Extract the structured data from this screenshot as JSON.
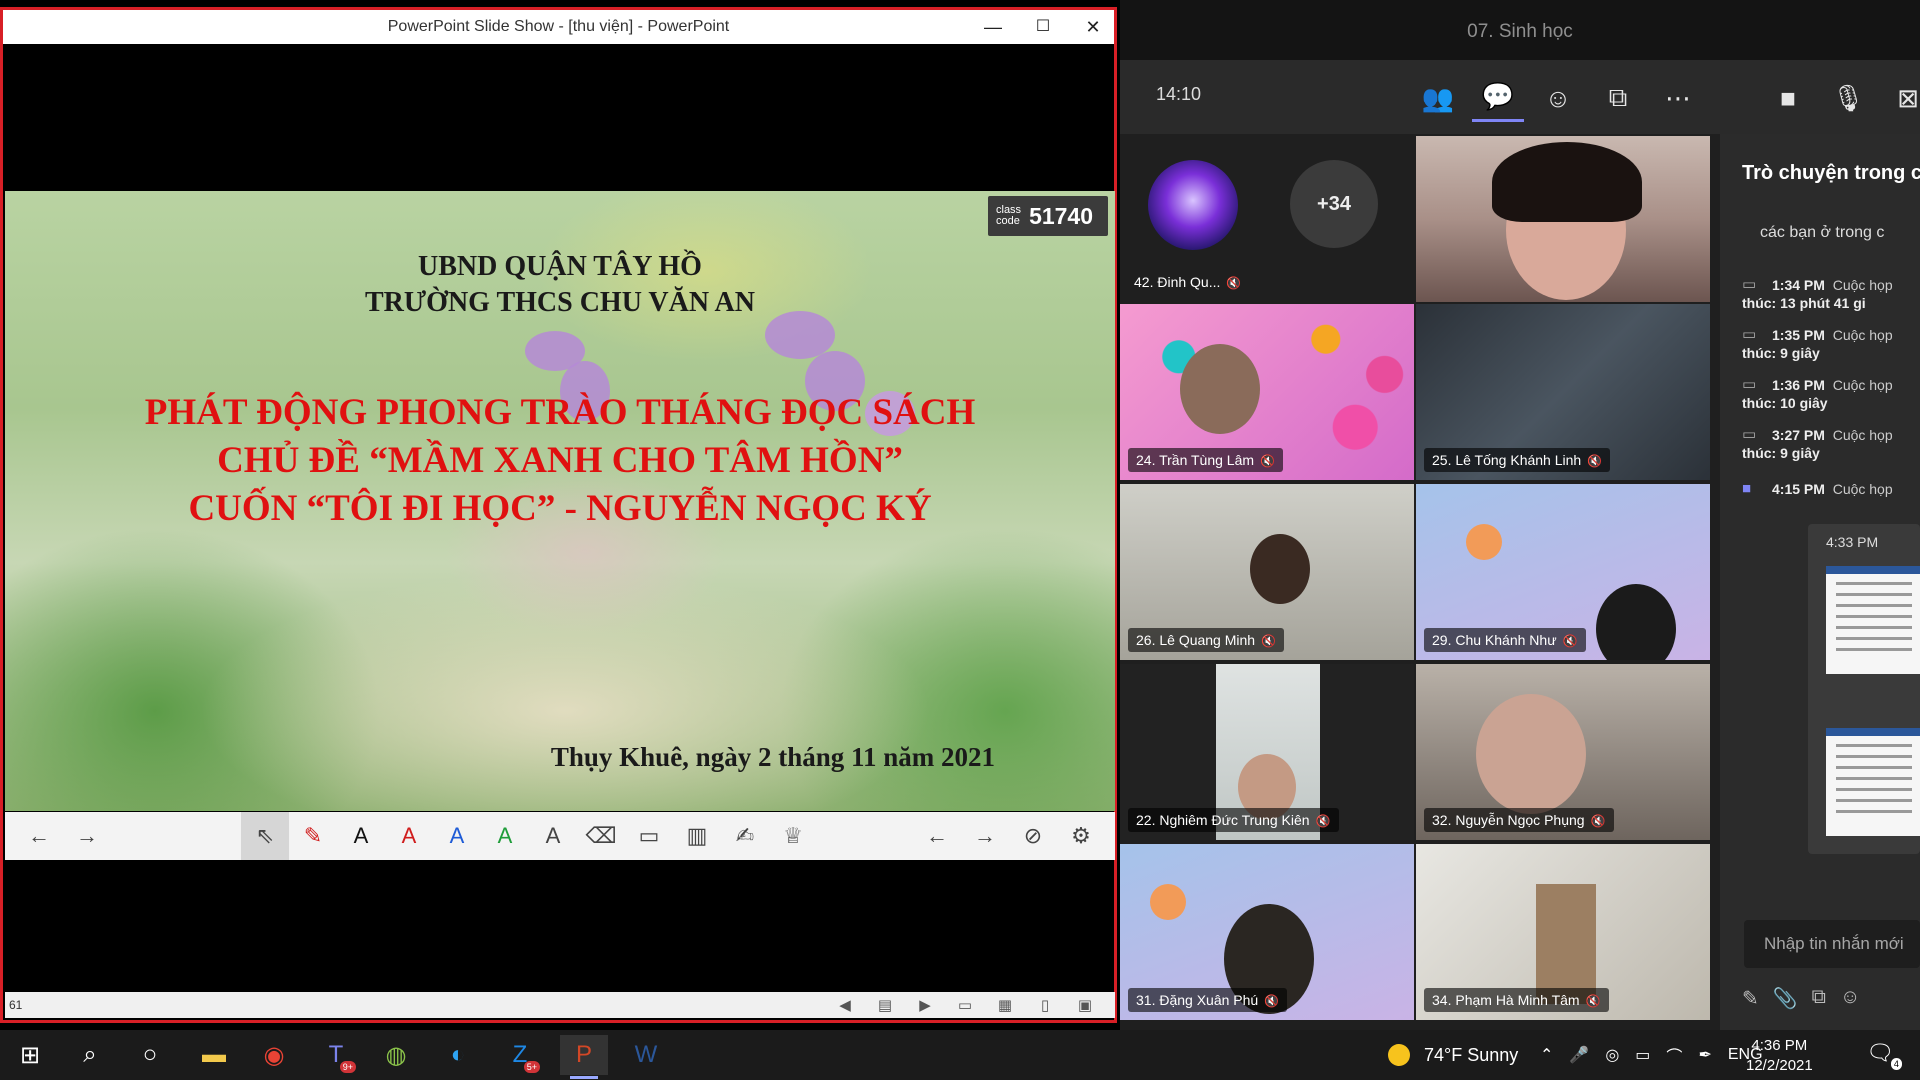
{
  "ppt": {
    "window_title": "PowerPoint Slide Show - [thu viện] - PowerPoint",
    "minimize_glyph": "—",
    "maximize_glyph": "☐",
    "close_glyph": "✕",
    "class_code_label": "class\ncode",
    "class_code": "51740",
    "slide": {
      "org_line1": "UBND QUẬN TÂY HỒ",
      "org_line2": "TRƯỜNG THCS CHU VĂN AN",
      "headline1": "PHÁT ĐỘNG PHONG TRÀO THÁNG ĐỌC SÁCH",
      "headline2": "CHỦ ĐỀ “MẦM XANH CHO TÂM HỒN”",
      "headline3": "CUỐN “TÔI ĐI HỌC”  - NGUYỄN NGỌC KÝ",
      "date_line": "Thụy Khuê, ngày 2 tháng 11 năm 2021"
    },
    "toolbar": {
      "prev": "←",
      "next": "→",
      "tools": [
        "⇖",
        "✎",
        "A",
        "A",
        "A",
        "A",
        "A",
        "⌫",
        "▭",
        "▥",
        "✍",
        "♕"
      ],
      "right_prev": "←",
      "right_next": "→",
      "hide": "⊘",
      "more": "⚙"
    },
    "status": {
      "slide_number": "61"
    },
    "colors": {
      "border": "#d81f26",
      "headline": "#e01010"
    }
  },
  "teams": {
    "meeting_title": "07. Sinh học",
    "timer": "14:10",
    "more_count": "+34",
    "participants": {
      "p42": "42. Đinh Qu...",
      "p24": "24. Trần Tùng Lâm",
      "p25": "25. Lê Tống Khánh Linh",
      "p26": "26. Lê Quang Minh",
      "p29": "29. Chu Khánh Như",
      "p22": "22. Nghiêm Đức Trung Kiên",
      "p32": "32. Nguyễn Ngọc Phụng",
      "p31": "31. Đặng Xuân Phú",
      "p34": "34. Phạm Hà Minh Tâm"
    },
    "chat": {
      "title": "Trò chuyện trong c",
      "preview": "các bạn ở trong c",
      "messages": [
        {
          "time": "1:34 PM",
          "text": "Cuộc họp",
          "detail": "thúc: 13 phút 41 gi"
        },
        {
          "time": "1:35 PM",
          "text": "Cuộc họp",
          "detail": "thúc: 9 giây"
        },
        {
          "time": "1:36 PM",
          "text": "Cuộc họp",
          "detail": "thúc: 10 giây"
        },
        {
          "time": "3:27 PM",
          "text": "Cuộc họp",
          "detail": "thúc: 9 giây"
        },
        {
          "time": "4:15 PM",
          "text": "Cuộc họp",
          "detail": ""
        }
      ],
      "image_time": "4:33 PM",
      "input_placeholder": "Nhập tin nhắn mới"
    },
    "colors": {
      "accent": "#7f85f5",
      "background": "#1f1f1f"
    }
  },
  "taskbar": {
    "teams_badge": "9+",
    "zalo_badge": "5+",
    "weather": "74°F  Sunny",
    "lang": "ENG",
    "time": "4:36 PM",
    "date": "12/2/2021",
    "notifications": "4"
  }
}
